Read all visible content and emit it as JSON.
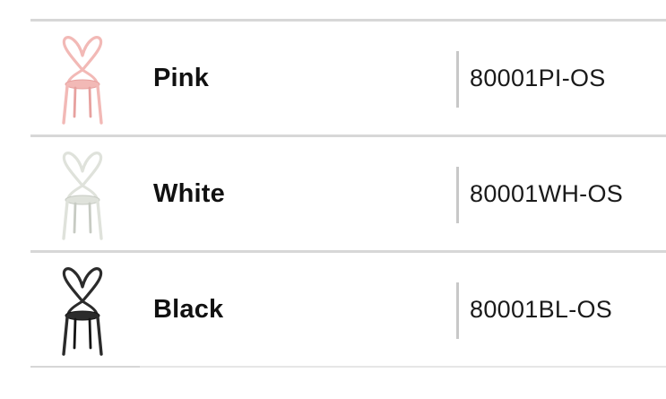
{
  "variants": [
    {
      "color_name": "Pink",
      "sku": "80001PI-OS",
      "chair_color": "#f2b9b6",
      "chair_shade": "#e7a19f"
    },
    {
      "color_name": "White",
      "sku": "80001WH-OS",
      "chair_color": "#dfe2db",
      "chair_shade": "#c7cbc3"
    },
    {
      "color_name": "Black",
      "sku": "80001BL-OS",
      "chair_color": "#2b2b2b",
      "chair_shade": "#141414"
    }
  ],
  "icons": {
    "thumbnail": "ribbon-chair-icon"
  }
}
